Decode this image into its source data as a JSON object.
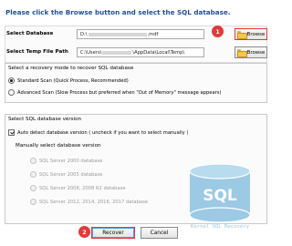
{
  "instruction": "Please click the Browse button and select the SQL database.",
  "database_row": {
    "label": "Select Database",
    "value_prefix": "D:\\",
    "value_suffix": ".mdf",
    "browse_label": "Browse",
    "step_badge": "1"
  },
  "temp_row": {
    "label": "Select Temp File Path",
    "value_prefix": "C:\\Users\\",
    "value_suffix": "\\AppData\\Local\\Temp\\",
    "browse_label": "Browse"
  },
  "recovery_mode": {
    "title": "Select a recovery mode to recover SQL database",
    "options": [
      {
        "label": "Standard Scan (Quick Process, Recommended)",
        "selected": true
      },
      {
        "label": "Advanced Scan (Slow Process but preferred when \"Out of Memory\" message appears)",
        "selected": false
      }
    ]
  },
  "version": {
    "title": "Select SQL database version",
    "auto_detect_label": "Auto detect database version ( uncheck if you want to select manually )",
    "auto_detect_checked": true,
    "manual_title": "Manually select database version",
    "options": [
      "SQL Server 2000 database",
      "SQL Server 2005 database",
      "SQL Server 2008, 2008 R2 database",
      "SQL Server 2012, 2014, 2016, 2017 database"
    ]
  },
  "watermark": {
    "icon_text": "SQL",
    "caption": "Kernel SQL Recovery"
  },
  "footer": {
    "recover_label": "Recover",
    "cancel_label": "Cancel",
    "step_badge": "2"
  },
  "colors": {
    "instruction_text": "#1f4e9c",
    "highlight": "#e03a3a",
    "db_icon": "#9cc9e4"
  }
}
